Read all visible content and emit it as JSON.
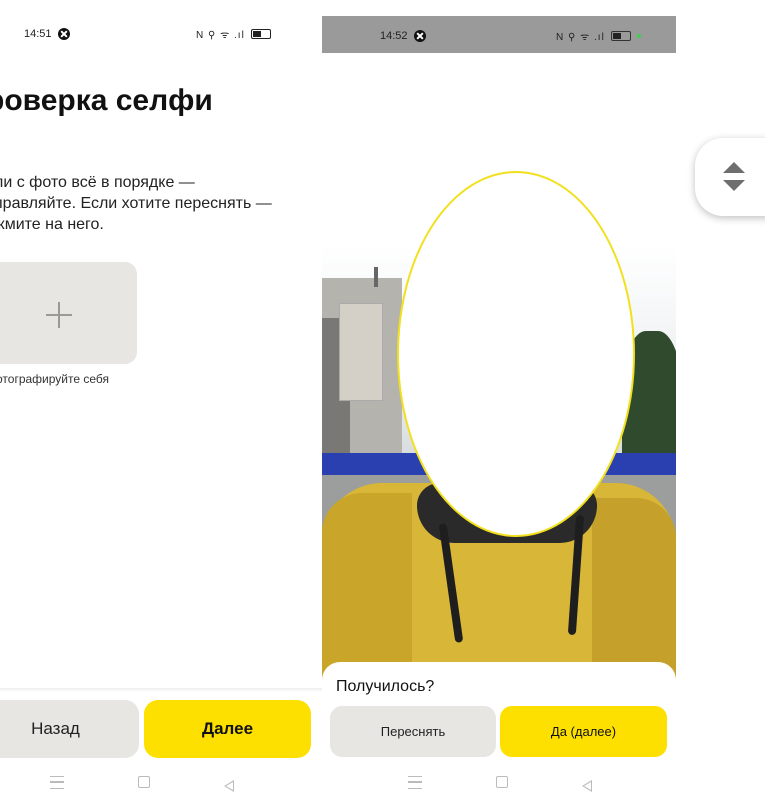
{
  "left_screen": {
    "status_bar": {
      "time": "14:51",
      "indicators": "N ⚲ ᯤ .ıl"
    },
    "title": "роверка селфи",
    "description_lines": [
      "ли с фото всё в порядке —",
      "правляйте. Если хотите переснять —",
      "жмите на него."
    ],
    "photo_tile_caption": "отографируйте себя",
    "buttons": {
      "back": "Назад",
      "next": "Далее"
    }
  },
  "right_screen": {
    "status_bar": {
      "time": "14:52",
      "indicators": "N ⚲ ᯤ .ıl"
    },
    "sheet": {
      "question": "Получилось?",
      "retake_button": "Переснять",
      "confirm_button": "Да (далее)"
    }
  },
  "colors": {
    "accent_yellow": "#fde000",
    "secondary_gray": "#e8e6e3",
    "oval_outline": "#f2e01e"
  },
  "icons": [
    "x-circle-icon",
    "battery-icon",
    "plus-icon",
    "menu-nav-icon",
    "home-nav-icon",
    "back-nav-icon",
    "scroll-up-icon",
    "scroll-down-icon"
  ]
}
